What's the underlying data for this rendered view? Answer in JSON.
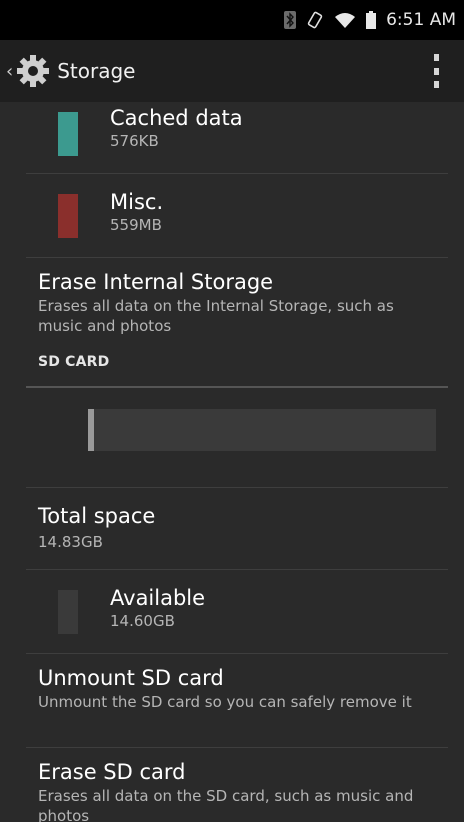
{
  "status_bar": {
    "time": "6:51 AM",
    "icons": [
      "bluetooth-icon",
      "vibrate-icon",
      "wifi-icon",
      "battery-icon"
    ]
  },
  "action_bar": {
    "title": "Storage",
    "icon": "gear-icon"
  },
  "internal_items": [
    {
      "label": "Cached data",
      "size": "576KB",
      "color": "#3c9a8f"
    },
    {
      "label": "Misc.",
      "size": "559MB",
      "color": "#8a2f2c"
    }
  ],
  "erase_internal": {
    "title": "Erase Internal Storage",
    "summary": "Erases all data on the Internal Storage, such as music and photos"
  },
  "sd_card": {
    "category": "SD CARD",
    "usage_fraction": 0.016,
    "total_space": {
      "title": "Total space",
      "value": "14.83GB"
    },
    "available": {
      "label": "Available",
      "size": "14.60GB",
      "color": "#3a3a3a"
    },
    "unmount": {
      "title": "Unmount SD card",
      "summary": "Unmount the SD card so you can safely remove it"
    },
    "erase": {
      "title": "Erase SD card",
      "summary": "Erases all data on the SD card, such as music and photos"
    }
  }
}
